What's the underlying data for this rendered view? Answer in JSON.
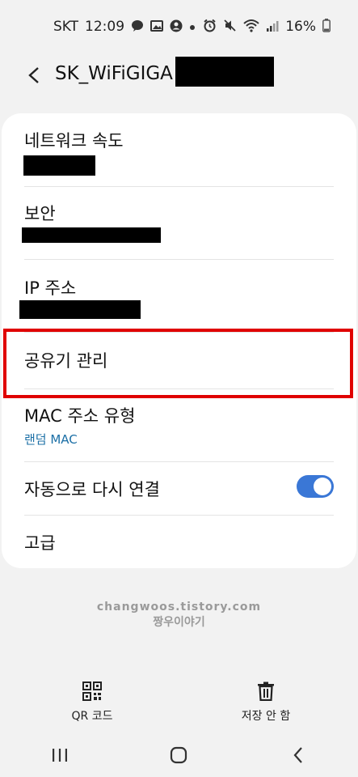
{
  "status_bar": {
    "carrier": "SKT",
    "time": "12:09",
    "battery": "16%"
  },
  "header": {
    "title": "SK_WiFiGIGA"
  },
  "settings": {
    "network_speed": {
      "label": "네트워크 속도"
    },
    "security": {
      "label": "보안"
    },
    "ip_address": {
      "label": "IP 주소"
    },
    "router_management": {
      "label": "공유기 관리"
    },
    "mac_type": {
      "label": "MAC 주소 유형",
      "value": "랜덤 MAC"
    },
    "auto_reconnect": {
      "label": "자동으로 다시 연결",
      "enabled": true
    },
    "advanced": {
      "label": "고급"
    }
  },
  "watermark": {
    "line1": "changwoos.tistory.com",
    "line2": "짱우이야기"
  },
  "bottom_actions": {
    "qr_code": "QR 코드",
    "forget": "저장 안 함"
  },
  "colors": {
    "accent": "#3a77d6",
    "link": "#1b6fa6",
    "highlight": "#e00000"
  }
}
